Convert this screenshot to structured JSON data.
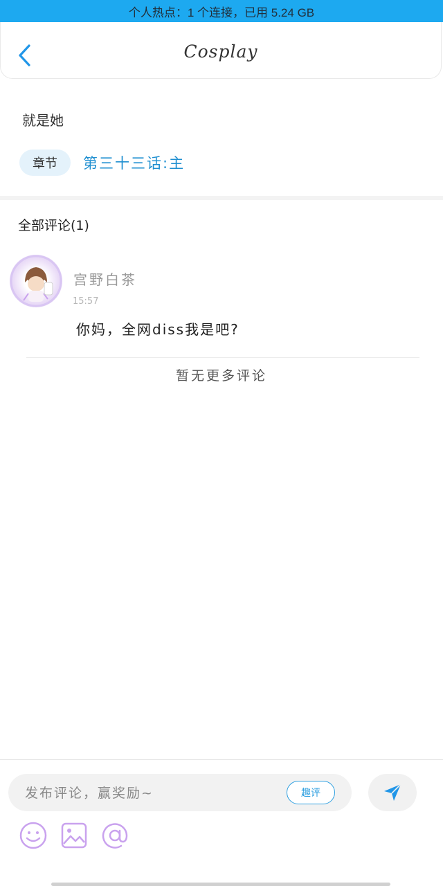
{
  "status_bar": {
    "text": "个人热点：1 个连接，已用 5.24 GB"
  },
  "header": {
    "title": "Cosplay",
    "back_icon": "chevron-left-icon"
  },
  "post": {
    "title": "就是她",
    "chapter_tag": "章节",
    "chapter_link": "第三十三话:主"
  },
  "comments": {
    "heading": "全部评论(1)",
    "items": [
      {
        "username": "宫野白茶",
        "time": "15:57",
        "text": "你妈，全网diss我是吧?"
      }
    ],
    "no_more": "暂无更多评论"
  },
  "composer": {
    "placeholder": "发布评论，赢奖励~",
    "funny_label": "趣评",
    "send_icon": "send-icon",
    "tools": [
      "emoji-icon",
      "image-icon",
      "at-icon"
    ]
  },
  "colors": {
    "status_bar": "#1da9f0",
    "accent": "#2d9fe0",
    "tool_icons": "#c9a2ee"
  }
}
